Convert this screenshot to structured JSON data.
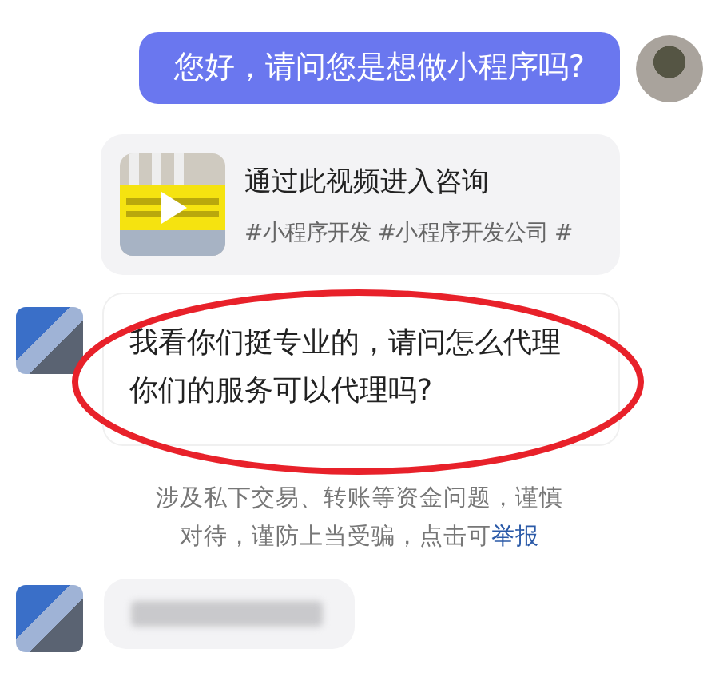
{
  "messages": [
    {
      "kind": "outgoing",
      "text": "您好，请问您是想做小程序吗?"
    },
    {
      "kind": "video_card",
      "title": "通过此视频进入咨询",
      "tags": "#小程序开发 #小程序开发公司 #"
    },
    {
      "kind": "incoming",
      "text": "我看你们挺专业的，请问怎么代理你们的服务可以代理吗?",
      "highlighted": true
    },
    {
      "kind": "notice",
      "text": "涉及私下交易、转账等资金问题，谨慎对待，谨防上当受骗，点击可",
      "link": "举报"
    },
    {
      "kind": "incoming_blurred"
    }
  ]
}
